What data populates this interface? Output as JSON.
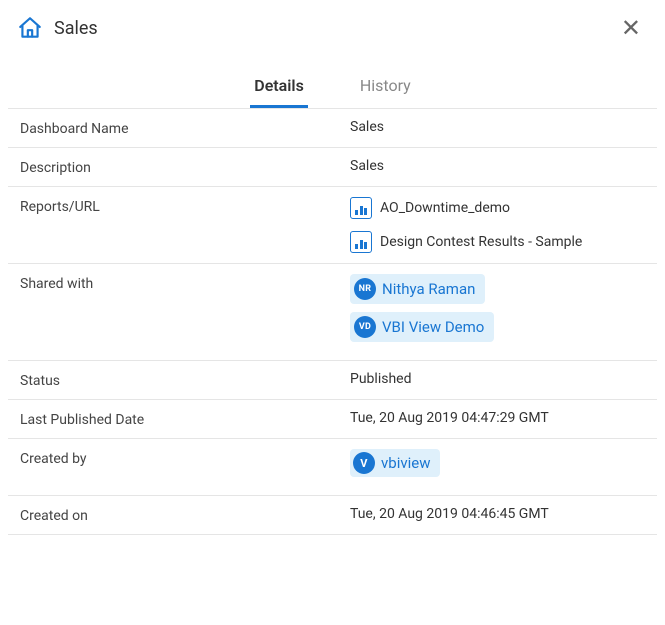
{
  "header": {
    "title": "Sales"
  },
  "tabs": {
    "details": "Details",
    "history": "History"
  },
  "fields": {
    "dashboardNameLabel": "Dashboard Name",
    "dashboardNameValue": "Sales",
    "descriptionLabel": "Description",
    "descriptionValue": "Sales",
    "reportsUrlLabel": "Reports/URL",
    "reports": [
      "AO_Downtime_demo",
      "Design Contest Results - Sample"
    ],
    "sharedWithLabel": "Shared with",
    "sharedWith": [
      {
        "initials": "NR",
        "name": "Nithya Raman"
      },
      {
        "initials": "VD",
        "name": "VBI View Demo"
      }
    ],
    "statusLabel": "Status",
    "statusValue": "Published",
    "lastPublishedLabel": "Last Published Date",
    "lastPublishedValue": "Tue, 20 Aug 2019 04:47:29 GMT",
    "createdByLabel": "Created by",
    "createdBy": {
      "initials": "V",
      "name": "vbiview"
    },
    "createdOnLabel": "Created on",
    "createdOnValue": "Tue, 20 Aug 2019 04:46:45 GMT"
  }
}
